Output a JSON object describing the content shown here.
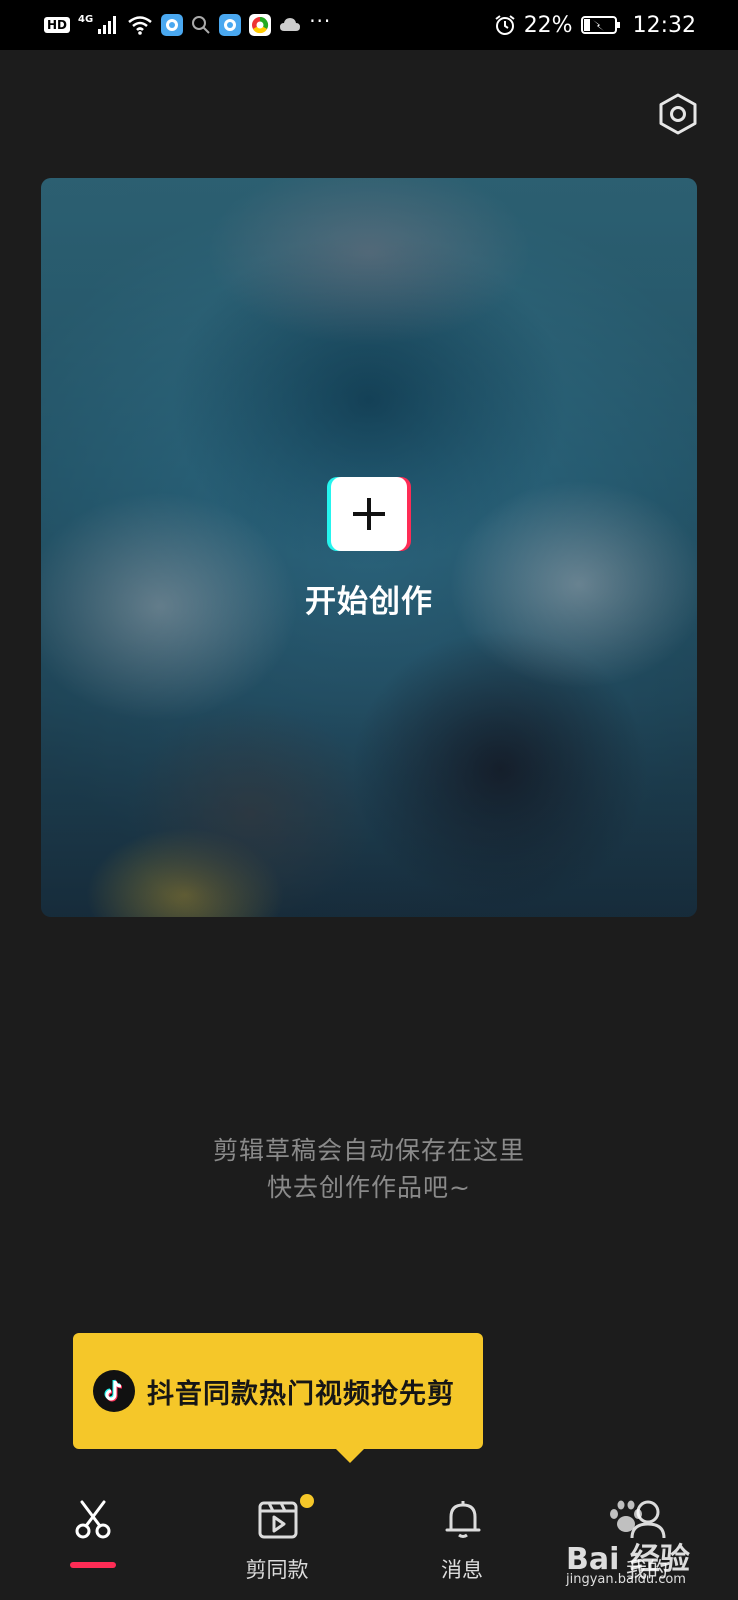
{
  "status_bar": {
    "hd": "HD",
    "network": "4G",
    "more": "···",
    "battery_percent": "22%",
    "time": "12:32"
  },
  "toolbar": {
    "settings_icon": "hexagon-settings-icon"
  },
  "hero": {
    "create_label": "开始创作",
    "plus_icon": "plus-icon"
  },
  "empty_state": {
    "line1": "剪辑草稿会自动保存在这里",
    "line2": "快去创作作品吧~"
  },
  "promo": {
    "text": "抖音同款热门视频抢先剪",
    "logo_icon": "tiktok-logo-icon"
  },
  "nav": {
    "items": [
      {
        "label": "",
        "icon": "scissors-icon",
        "active": true
      },
      {
        "label": "剪同款",
        "icon": "video-template-icon",
        "badge": true
      },
      {
        "label": "消息",
        "icon": "bell-icon"
      },
      {
        "label": "我的",
        "icon": "profile-icon"
      }
    ]
  },
  "watermark": {
    "brand": "Bai 经验",
    "site": "jingyan.baidu.com"
  },
  "colors": {
    "accent_red": "#fe2c55",
    "accent_cyan": "#25f4ee",
    "promo_yellow": "#f5c729",
    "background": "#1c1c1c"
  }
}
